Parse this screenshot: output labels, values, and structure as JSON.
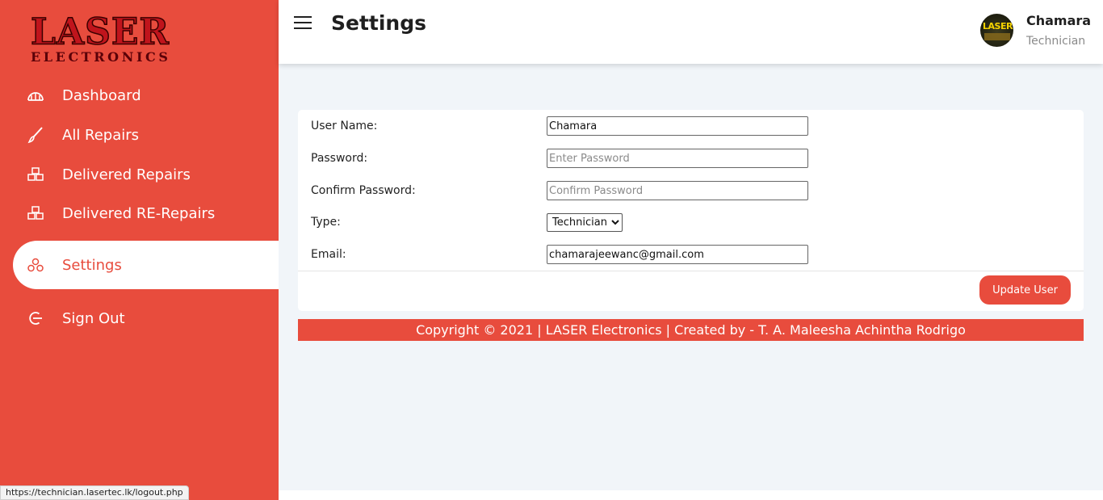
{
  "logo": {
    "big": "LASER",
    "small": "ELECTRONICS"
  },
  "sidebar": {
    "items": [
      {
        "label": "Dashboard",
        "icon": "dashboard-icon"
      },
      {
        "label": "All Repairs",
        "icon": "brush-icon"
      },
      {
        "label": "Delivered Repairs",
        "icon": "boxes-icon"
      },
      {
        "label": "Delivered RE-Repairs",
        "icon": "boxes-icon"
      },
      {
        "label": "Settings",
        "icon": "settings-icon",
        "active": true
      },
      {
        "label": "Sign Out",
        "icon": "sign-out-icon"
      }
    ]
  },
  "header": {
    "title": "Settings",
    "user_name": "Chamara",
    "user_role": "Technician",
    "avatar_text": "LASER"
  },
  "form": {
    "username_label": "User Name:",
    "username_value": "Chamara",
    "password_label": "Password:",
    "password_placeholder": "Enter Password",
    "confirm_label": "Confirm Password:",
    "confirm_placeholder": "Confirm Password",
    "type_label": "Type:",
    "type_value": "Technician",
    "email_label": "Email:",
    "email_value": "chamarajeewanc@gmail.com",
    "submit_label": "Update User"
  },
  "footer": {
    "text": "Copyright © 2021 | LASER Electronics | Created by - T. A. Maleesha Achintha Rodrigo"
  },
  "status_bar": {
    "url": "https://technician.lasertec.lk/logout.php"
  },
  "colors": {
    "accent": "#e84c3d",
    "background": "#f1f5f9"
  }
}
